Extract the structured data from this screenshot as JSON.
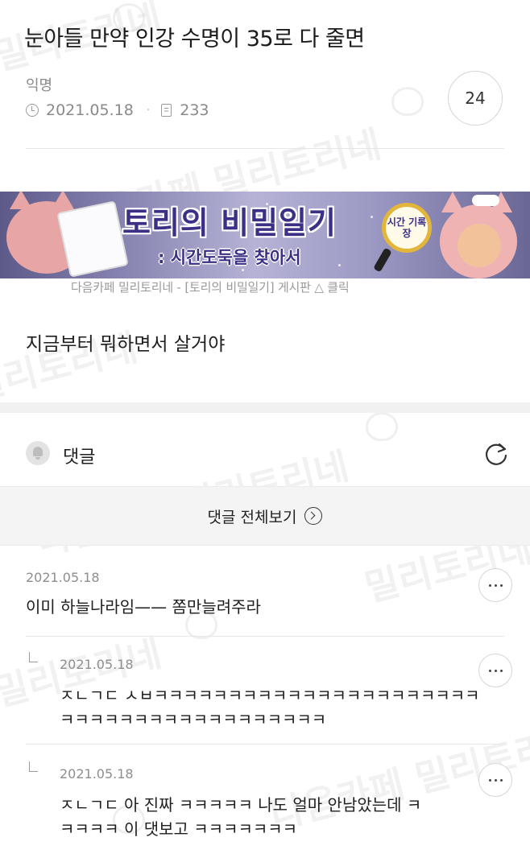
{
  "post": {
    "title": "눈아들 만약 인강 수명이 35로 다 줄면",
    "author": "익명",
    "date": "2021.05.18",
    "views": "233",
    "comment_count": "24",
    "body": "지금부터 뭐하면서 살거야"
  },
  "banner": {
    "title": "토리의 비밀일기",
    "subtitle": ": 시간도둑을 찾아서",
    "badge": "시간 기록장",
    "caption": "다음카페 밀리토리네 - [토리의 비밀일기] 게시판 △ 클릭"
  },
  "comments": {
    "section_label": "댓글",
    "view_all_label": "댓글 전체보기",
    "items": [
      {
        "date": "2021.05.18",
        "lines": [
          "이미 하늘나라임—— 쫌만늘려주라"
        ],
        "reply": false
      },
      {
        "date": "2021.05.18",
        "lines": [
          "ㅈㄴㄱㄷ ㅅㅂㅋㅋㅋㅋㅋㅋㅋㅋㅋㅋㅋㅋㅋㅋㅋㅋㅋㅋㅋㅋㅋㅋ",
          "ㅋㅋㅋㅋㅋㅋㅋㅋㅋㅋㅋㅋㅋㅋㅋㅋㅋㅋ"
        ],
        "reply": true
      },
      {
        "date": "2021.05.18",
        "lines": [
          "ㅈㄴㄱㄷ  아 진짜 ㅋㅋㅋㅋㅋ 나도 얼마 안남았는데 ㅋ",
          "ㅋㅋㅋㅋ 이 댓보고 ㅋㅋㅋㅋㅋㅋㅋ"
        ],
        "reply": true
      }
    ]
  },
  "watermark": {
    "text_a": "다음카페 밀리토리네",
    "text_b": "밀리토리네"
  },
  "icons": {
    "views": "document-icon",
    "date": "clock-icon",
    "comments": "bell-icon",
    "refresh": "refresh-icon",
    "more": "more-icon",
    "view_all": "chevron-right-circle-icon",
    "reply": "reply-arrow-icon"
  },
  "colors": {
    "banner_title": "#3b2f86",
    "badge_ring": "#e3b53b",
    "divider": "#f1f1f1"
  }
}
